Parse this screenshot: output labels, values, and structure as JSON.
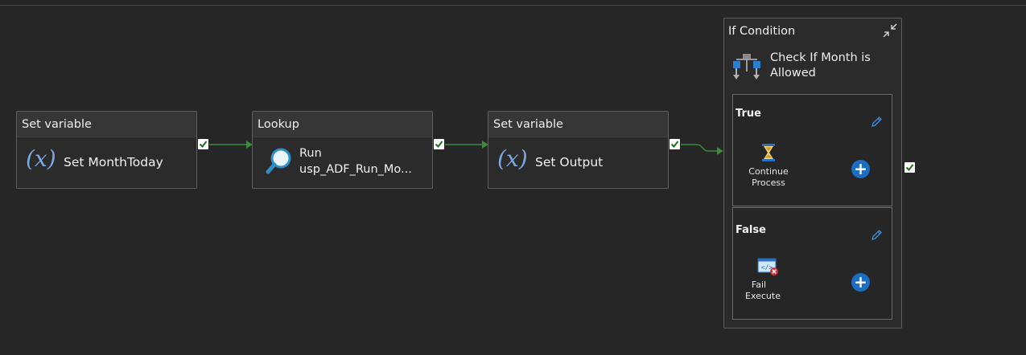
{
  "canvas": {
    "activities": [
      {
        "type": "Set variable",
        "name": "Set MonthToday",
        "icon": "variable-icon"
      },
      {
        "type": "Lookup",
        "name_line1": "Run",
        "name_line2": "usp_ADF_Run_Mo...",
        "icon": "lookup-icon"
      },
      {
        "type": "Set variable",
        "name": "Set Output",
        "icon": "variable-icon"
      }
    ],
    "if_condition": {
      "type": "If Condition",
      "name_line1": "Check If Month is",
      "name_line2": "Allowed",
      "true_branch": {
        "label": "True",
        "activity_line1": "Continue",
        "activity_line2": "Process",
        "activity_icon": "hourglass-icon"
      },
      "false_branch": {
        "label": "False",
        "activity_line1": "Fail",
        "activity_line2": "Execute",
        "activity_icon": "fail-icon"
      }
    },
    "variable_glyph": "(x)",
    "colors": {
      "background": "#262626",
      "success_wire": "#3b8a3b",
      "accent": "#1b6ec2",
      "variable_icon": "#7ea6e0"
    }
  }
}
